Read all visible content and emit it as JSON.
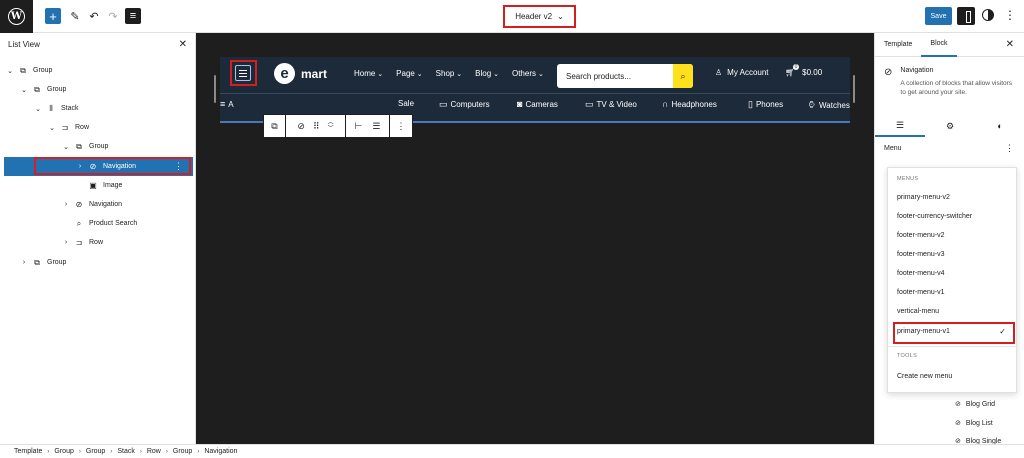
{
  "topbar": {
    "doc_title": "Header v2",
    "save_label": "Save"
  },
  "list_view": {
    "title": "List View",
    "items": [
      {
        "label": "Group",
        "icon": "group-icon"
      },
      {
        "label": "Group",
        "icon": "group-icon"
      },
      {
        "label": "Stack",
        "icon": "stack-icon"
      },
      {
        "label": "Row",
        "icon": "row-icon"
      },
      {
        "label": "Group",
        "icon": "group-icon"
      },
      {
        "label": "Navigation",
        "icon": "navigation-icon",
        "selected": true
      },
      {
        "label": "Image",
        "icon": "image-icon"
      },
      {
        "label": "Navigation",
        "icon": "navigation-icon"
      },
      {
        "label": "Product Search",
        "icon": "search-icon"
      },
      {
        "label": "Row",
        "icon": "row-icon"
      },
      {
        "label": "Group",
        "icon": "group-icon"
      }
    ]
  },
  "canvas": {
    "logo_letter": "e",
    "logo_text": "mart",
    "nav_items": [
      "Home",
      "Page",
      "Shop",
      "Blog",
      "Others"
    ],
    "search_placeholder": "Search products...",
    "account_label": "My Account",
    "cart_total": "$0.00",
    "cart_count": "0",
    "categories": [
      "A",
      "Sale",
      "Computers",
      "Cameras",
      "TV & Video",
      "Headphones",
      "Phones",
      "Watches"
    ]
  },
  "sidebar": {
    "tabs": [
      "Template",
      "Block"
    ],
    "active_tab": "Block",
    "block_title": "Navigation",
    "block_desc": "A collection of blocks that allow visitors to get around your site.",
    "menu_label": "Menu",
    "dropdown": {
      "menus_heading": "MENUS",
      "menus": [
        "primary-menu-v2",
        "footer-currency-switcher",
        "footer-menu-v2",
        "footer-menu-v3",
        "footer-menu-v4",
        "footer-menu-v1",
        "vertical-menu",
        "primary-menu-v1"
      ],
      "selected": "primary-menu-v1",
      "tools_heading": "TOOLS",
      "tools": [
        "Create new menu"
      ]
    },
    "peek_items": [
      "Blog Grid",
      "Blog List",
      "Blog Single"
    ]
  },
  "breadcrumb": [
    "Template",
    "Group",
    "Group",
    "Stack",
    "Row",
    "Group",
    "Navigation"
  ],
  "colors": {
    "accent": "#2271b1",
    "highlight": "#d31f1f",
    "header_bg": "#1d2a3a",
    "search_button": "#ffe01a"
  }
}
